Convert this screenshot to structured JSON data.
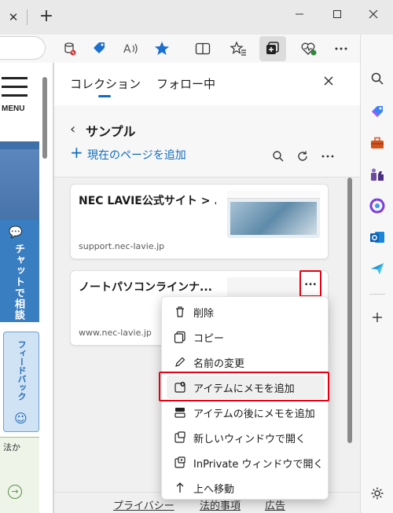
{
  "browser": {
    "titlebar": {
      "tab_close_glyph": "✕",
      "newtab_glyph": "+"
    },
    "toolbar": {
      "icons": [
        "database-blocked-icon",
        "tag-icon",
        "read-aloud-icon",
        "favorite-star-icon",
        "split-screen-icon",
        "favorites-list-icon",
        "collections-icon",
        "browser-essentials-icon",
        "more-icon",
        "copilot-icon"
      ],
      "accent": "#0f6cbd"
    }
  },
  "page": {
    "menu_label": "MENU",
    "chat_label": "チャットで相談",
    "feedback_label": "フィードバック",
    "footer_fragment": "法か"
  },
  "collections": {
    "tabs": [
      {
        "label": "コレクション",
        "active": true
      },
      {
        "label": "フォロー中",
        "active": false
      }
    ],
    "collection_title": "サンプル",
    "add_current_page": "現在のページを追加",
    "items": [
      {
        "title": "NEC LAVIE公式サイト > ...",
        "url": "support.nec-lavie.jp"
      },
      {
        "title": "ノートパソコンラインナ...",
        "url": "www.nec-lavie.jp"
      }
    ],
    "more_glyph": "...",
    "footer_links": [
      "プライバシー",
      "法的事項",
      "広告"
    ]
  },
  "context_menu": {
    "items": [
      {
        "label": "削除",
        "icon": "trash-icon"
      },
      {
        "label": "コピー",
        "icon": "copy-icon"
      },
      {
        "label": "名前の変更",
        "icon": "rename-pencil-icon"
      },
      {
        "label": "アイテムにメモを追加",
        "icon": "add-note-icon",
        "highlighted": true
      },
      {
        "label": "アイテムの後にメモを追加",
        "icon": "add-note-after-icon"
      },
      {
        "label": "新しいウィンドウで開く",
        "icon": "new-window-icon"
      },
      {
        "label": "InPrivate ウィンドウで開く",
        "icon": "inprivate-window-icon"
      },
      {
        "label": "上へ移動",
        "icon": "arrow-up-icon"
      }
    ],
    "highlight_color": "#e60012"
  },
  "sidebar": {
    "icons": [
      "search-icon",
      "tag-icon",
      "toolbox-icon",
      "games-icon",
      "microsoft365-icon",
      "outlook-icon",
      "send-icon",
      "add-icon",
      "settings-gear-icon"
    ]
  }
}
